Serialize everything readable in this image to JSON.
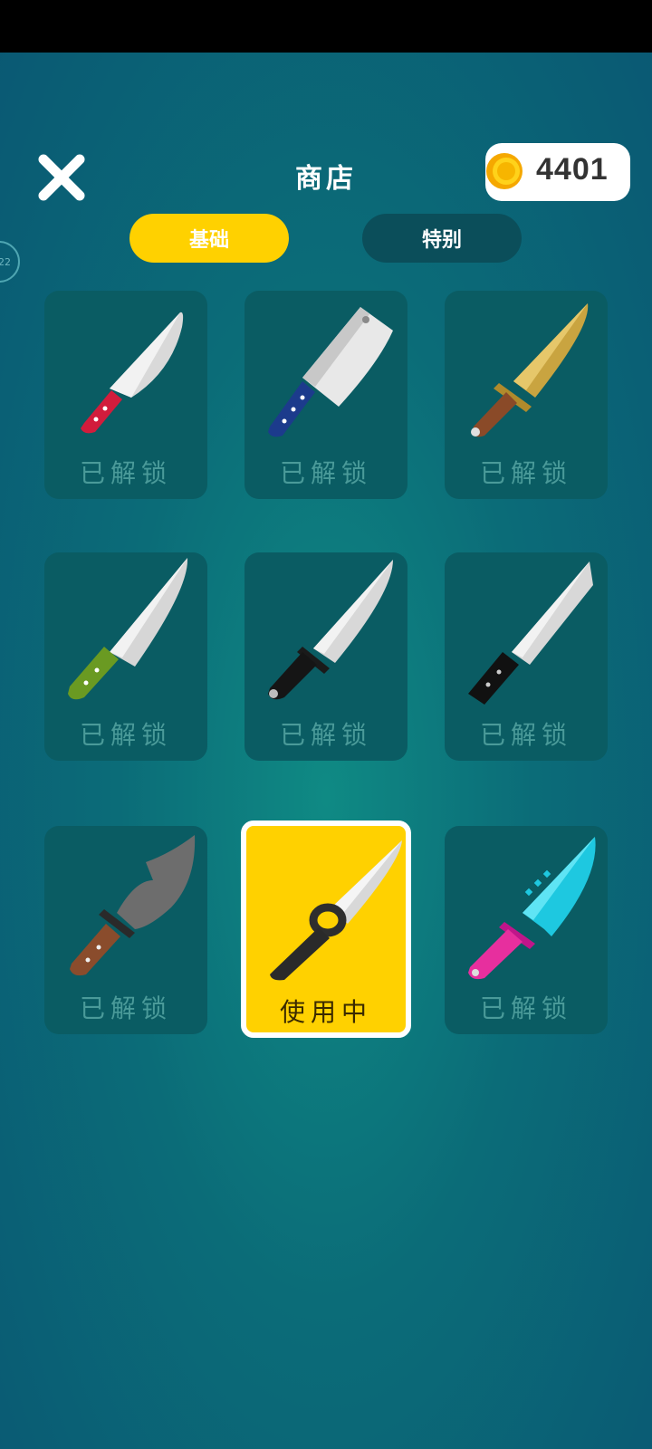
{
  "header": {
    "title": "商店",
    "coins": "4401"
  },
  "level_badge": "22",
  "tabs": [
    {
      "label": "基础",
      "selected": true
    },
    {
      "label": "特别",
      "selected": false
    }
  ],
  "items": [
    {
      "name": "red-handle-chef-knife",
      "status": "已解锁"
    },
    {
      "name": "blue-handle-cleaver",
      "status": "已解锁"
    },
    {
      "name": "golden-dagger",
      "status": "已解锁"
    },
    {
      "name": "green-handle-knife",
      "status": "已解锁"
    },
    {
      "name": "black-grip-knife",
      "status": "已解锁"
    },
    {
      "name": "tanto-knife",
      "status": "已解锁"
    },
    {
      "name": "curved-machete",
      "status": "已解锁"
    },
    {
      "name": "ring-handle-kunai",
      "status": "使用中"
    },
    {
      "name": "cyan-serrated-knife",
      "status": "已解锁"
    }
  ],
  "colors": {
    "accent": "#ffd100",
    "card_bg": "#0a5c63",
    "tab_inactive": "#0b4e5a"
  }
}
